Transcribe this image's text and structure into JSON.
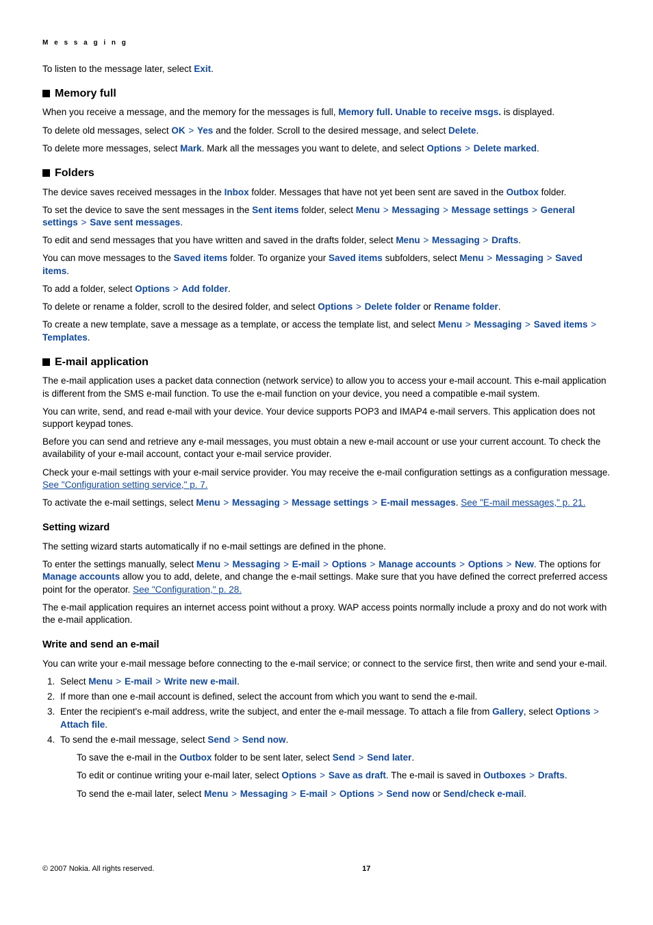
{
  "header": {
    "section": "M e s s a g i n g"
  },
  "sep": ">",
  "intro": {
    "listen_later_pre": "To listen to the message later, select ",
    "listen_later_term": "Exit",
    "listen_later_post": "."
  },
  "memory_full": {
    "heading": "Memory full",
    "p1_pre": "When you receive a message, and the memory for the messages is full, ",
    "p1_term": "Memory full. Unable to receive msgs.",
    "p1_post": " is displayed.",
    "p2_pre": "To delete old messages, select ",
    "p2_ok": "OK",
    "p2_yes": "Yes",
    "p2_mid": " and the folder. Scroll to the desired message, and select ",
    "p2_delete": "Delete",
    "p2_post": ".",
    "p3_pre": "To delete more messages, select ",
    "p3_mark": "Mark",
    "p3_mid": ". Mark all the messages you want to delete, and select ",
    "p3_options": "Options",
    "p3_delmark": "Delete marked",
    "p3_post": "."
  },
  "folders": {
    "heading": "Folders",
    "p1_pre": "The device saves received messages in the ",
    "p1_inbox": "Inbox",
    "p1_mid": " folder. Messages that have not yet been sent are saved in the ",
    "p1_outbox": "Outbox",
    "p1_post": " folder.",
    "p2_pre": "To set the device to save the sent messages in the ",
    "p2_sentitems": "Sent items",
    "p2_mid": " folder, select ",
    "p2_menu": "Menu",
    "p2_messaging": "Messaging",
    "p2_msgset": "Message settings",
    "p2_genset": "General settings",
    "p2_savesent": "Save sent messages",
    "p2_post": ".",
    "p3_pre": "To edit and send messages that you have written and saved in the drafts folder, select ",
    "p3_menu": "Menu",
    "p3_messaging": "Messaging",
    "p3_drafts": "Drafts",
    "p3_post": ".",
    "p4_pre": "You can move messages to the ",
    "p4_saved": "Saved items",
    "p4_mid": " folder. To organize your ",
    "p4_saved2": "Saved items",
    "p4_mid2": " subfolders, select ",
    "p4_menu": "Menu",
    "p4_messaging": "Messaging",
    "p4_saved3": "Saved items",
    "p4_post": ".",
    "p5_pre": "To add a folder, select ",
    "p5_options": "Options",
    "p5_addfolder": "Add folder",
    "p5_post": ".",
    "p6_pre": "To delete or rename a folder, scroll to the desired folder, and select ",
    "p6_options": "Options",
    "p6_delfolder": "Delete folder",
    "p6_or": " or ",
    "p6_renfolder": "Rename folder",
    "p6_post": ".",
    "p7_pre": "To create a new template, save a message as a template, or access the template list, and select ",
    "p7_menu": "Menu",
    "p7_messaging": "Messaging",
    "p7_saved": "Saved items",
    "p7_templates": "Templates",
    "p7_post": "."
  },
  "email_app": {
    "heading": "E-mail application",
    "p1": "The e-mail application uses a packet data connection (network service) to allow you to access your e-mail account. This e-mail application is different from the SMS e-mail function. To use the e-mail function on your device, you need a compatible e-mail system.",
    "p2": "You can write, send, and read e-mail with your device. Your device supports POP3 and IMAP4 e-mail servers. This application does not support keypad tones.",
    "p3": "Before you can send and retrieve any e-mail messages, you must obtain a new e-mail account or use your current account. To check the availability of your e-mail account, contact your e-mail service provider.",
    "p4_pre": "Check your e-mail settings with your e-mail service provider. You may receive the e-mail configuration settings as a configuration message. ",
    "p4_link": "See \"Configuration setting service,\" p. 7.",
    "p5_pre": "To activate the e-mail settings, select ",
    "p5_menu": "Menu",
    "p5_messaging": "Messaging",
    "p5_msgset": "Message settings",
    "p5_emailmsg": "E-mail messages",
    "p5_dot": ". ",
    "p5_link": "See \"E-mail messages,\" p. 21."
  },
  "setting_wizard": {
    "heading": "Setting wizard",
    "p1": "The setting wizard starts automatically if no e-mail settings are defined in the phone.",
    "p2_pre": "To enter the settings manually, select ",
    "p2_menu": "Menu",
    "p2_messaging": "Messaging",
    "p2_email": "E-mail",
    "p2_options": "Options",
    "p2_manage": "Manage accounts",
    "p2_options2": "Options",
    "p2_new": "New",
    "p2_post": ". The options for ",
    "p2_manage2": "Manage accounts",
    "p2_post2": " allow you to add, delete, and change the e-mail settings. Make sure that you have defined the correct preferred access point for the operator. ",
    "p2_link": "See \"Configuration,\" p. 28.",
    "p3": "The e-mail application requires an internet access point without a proxy. WAP access points normally include a proxy and do not work with the e-mail application."
  },
  "write_send": {
    "heading": "Write and send an e-mail",
    "intro": "You can write your e-mail message before connecting to the e-mail service; or connect to the service first, then write and send your e-mail.",
    "li1_pre": "Select ",
    "li1_menu": "Menu",
    "li1_email": "E-mail",
    "li1_write": "Write new e-mail",
    "li1_post": ".",
    "li2": "If more than one e-mail account is defined, select the account from which you want to send the e-mail.",
    "li3_pre": "Enter the recipient's e-mail address, write the subject, and enter the e-mail message. To attach a file from ",
    "li3_gallery": "Gallery",
    "li3_mid": ", select ",
    "li3_options": "Options",
    "li3_attach": "Attach file",
    "li3_post": ".",
    "li4_pre": "To send the e-mail message, select ",
    "li4_send": "Send",
    "li4_sendnow": "Send now",
    "li4_post": ".",
    "li4a_pre": "To save the e-mail in the ",
    "li4a_outbox": "Outbox",
    "li4a_mid": " folder to be sent later, select ",
    "li4a_send": "Send",
    "li4a_sendlater": "Send later",
    "li4a_post": ".",
    "li4b_pre": "To edit or continue writing your e-mail later, select ",
    "li4b_options": "Options",
    "li4b_saveas": "Save as draft",
    "li4b_mid": ". The e-mail is saved in ",
    "li4b_outboxes": "Outboxes",
    "li4b_drafts": "Drafts",
    "li4b_post": ".",
    "li4c_pre": "To send the e-mail later, select ",
    "li4c_menu": "Menu",
    "li4c_messaging": "Messaging",
    "li4c_email": "E-mail",
    "li4c_options": "Options",
    "li4c_sendnow": "Send now",
    "li4c_or": " or ",
    "li4c_sendcheck": "Send/check e-mail",
    "li4c_post": "."
  },
  "footer": {
    "copyright": "© 2007 Nokia. All rights reserved.",
    "pagenum": "17"
  }
}
